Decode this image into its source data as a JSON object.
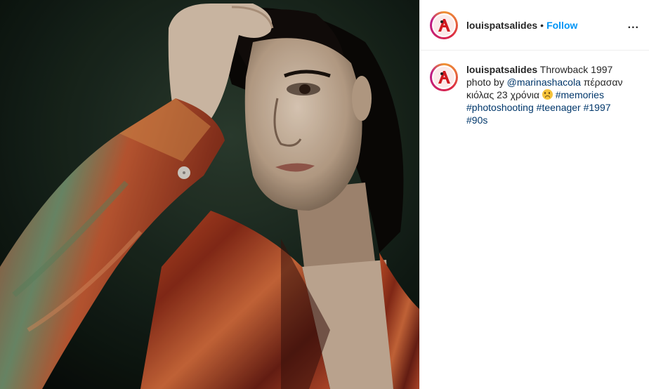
{
  "post": {
    "photo_alt": "Throwback 1997 portrait photo",
    "header": {
      "username": "louispatsalides",
      "separator": "•",
      "follow_label": "Follow",
      "more_label": "..."
    },
    "caption": {
      "username": "louispatsalides",
      "text_1": "Throwback 1997 photo by ",
      "mention": "@marinashacola",
      "text_2": " πέρασαν κιόλας 23 χρόνια ",
      "emoji": "sad-face-emoji",
      "hashtags": [
        "#memories",
        "#photoshooting",
        "#teenager",
        "#1997",
        "#90s"
      ]
    }
  },
  "colors": {
    "follow": "#0095f6",
    "link": "#00376b",
    "text": "#262626",
    "border": "#efefef"
  }
}
